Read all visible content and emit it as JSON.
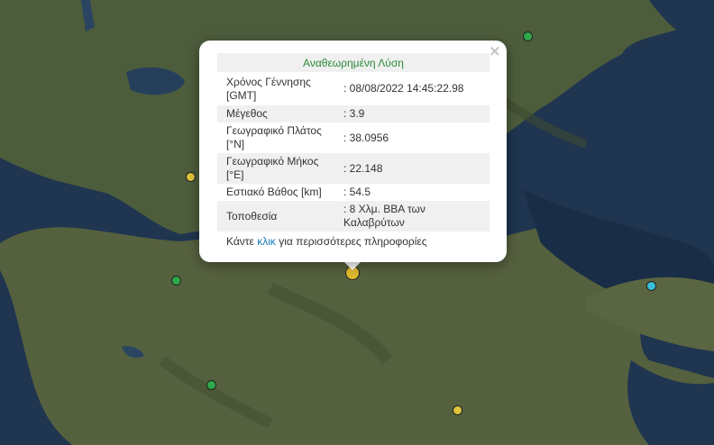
{
  "popup": {
    "title": "Αναθεωρημένη Λύση",
    "close": "×",
    "rows": [
      {
        "label": "Χρόνος Γέννησης [GMT]",
        "value": ": 08/08/2022 14:45:22.98"
      },
      {
        "label": "Μέγεθος",
        "value": ": 3.9"
      },
      {
        "label": "Γεωγραφικό Πλάτος [°N]",
        "value": ": 38.0956"
      },
      {
        "label": "Γεωγραφικό Μήκος [°E]",
        "value": ": 22.148"
      },
      {
        "label": "Εστιακό Βάθος [km]",
        "value": ": 54.5"
      },
      {
        "label": "Τοποθεσία",
        "value": ": 8 Χλμ. ΒΒΑ των Καλαβρύτων"
      }
    ],
    "more_prefix": "Κάντε ",
    "more_link": "κλικ",
    "more_suffix": " για περισσότερες πληροφορίες"
  },
  "colors": {
    "green": "#2ea84a",
    "yellow": "#e0c43a",
    "cyan": "#3bbfd8",
    "title_text": "#2a8a3a",
    "link": "#1a7ab8"
  }
}
